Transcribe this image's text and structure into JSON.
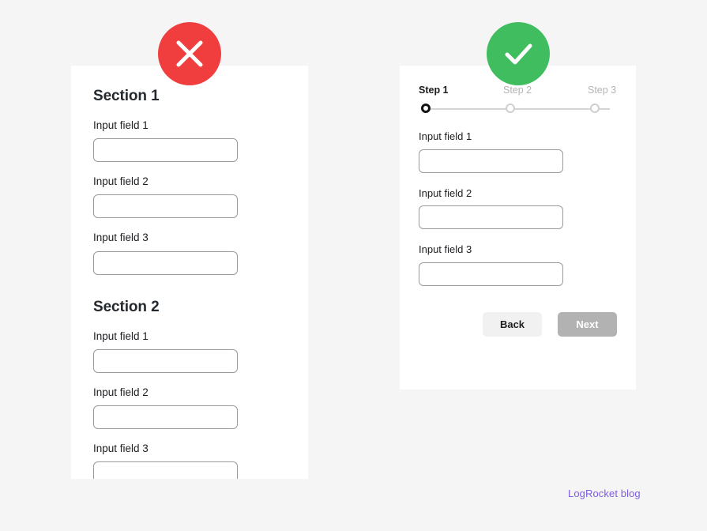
{
  "colors": {
    "background": "#f5f5f5",
    "card": "#ffffff",
    "error_badge": "#f03e3e",
    "success_badge": "#3fbd5f",
    "input_border": "#9a9a9a",
    "step_active": "#141414",
    "step_inactive": "#cfcfcf",
    "button_secondary": "#f1f1f1",
    "button_primary_disabled": "#b2b2b2",
    "brand_link": "#7d5ce0"
  },
  "bad_example": {
    "badge_icon": "close-x-icon",
    "badge_label": "Incorrect example",
    "sections": [
      {
        "title": "Section 1",
        "fields": [
          {
            "label": "Input field 1",
            "value": "",
            "placeholder": ""
          },
          {
            "label": "Input field 2",
            "value": "",
            "placeholder": ""
          },
          {
            "label": "Input field 3",
            "value": "",
            "placeholder": ""
          }
        ]
      },
      {
        "title": "Section 2",
        "fields": [
          {
            "label": "Input field 1",
            "value": "",
            "placeholder": ""
          },
          {
            "label": "Input field 2",
            "value": "",
            "placeholder": ""
          },
          {
            "label": "Input field 3",
            "value": "",
            "placeholder": ""
          }
        ]
      }
    ]
  },
  "good_example": {
    "badge_icon": "checkmark-icon",
    "badge_label": "Correct example",
    "stepper": {
      "steps": [
        {
          "label": "Step 1",
          "state": "active"
        },
        {
          "label": "Step 2",
          "state": "inactive"
        },
        {
          "label": "Step 3",
          "state": "inactive"
        }
      ]
    },
    "fields": [
      {
        "label": "Input field 1",
        "value": "",
        "placeholder": ""
      },
      {
        "label": "Input field 2",
        "value": "",
        "placeholder": ""
      },
      {
        "label": "Input field 3",
        "value": "",
        "placeholder": ""
      }
    ],
    "buttons": {
      "back_label": "Back",
      "next_label": "Next"
    }
  },
  "footer": {
    "credit": "LogRocket blog"
  }
}
